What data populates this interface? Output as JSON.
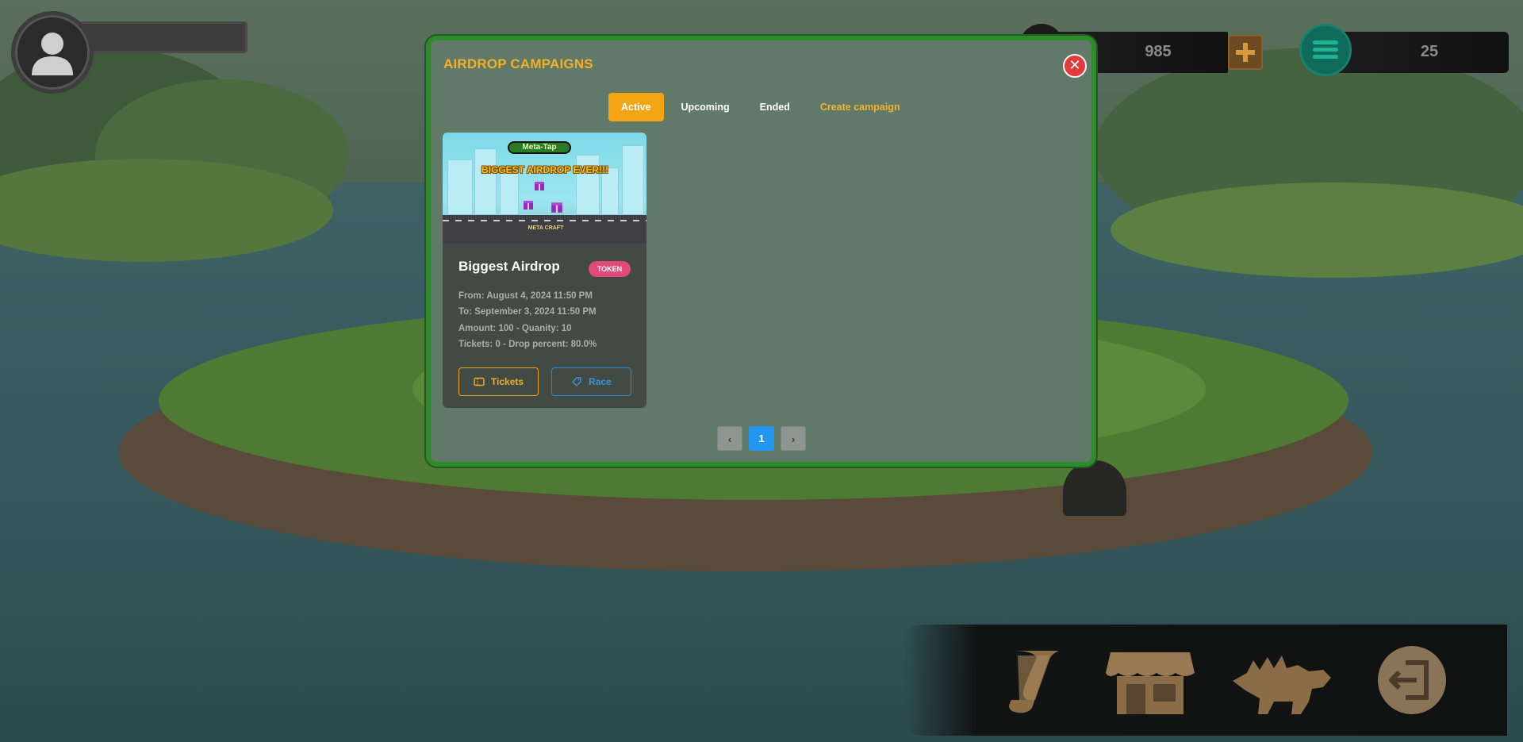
{
  "hud": {
    "currency_primary": "985",
    "currency_secondary": "25",
    "plus_icon": "plus-icon",
    "menu_icon": "stack-icon"
  },
  "modal": {
    "title": "AIRDROP CAMPAIGNS",
    "close_icon": "close-icon",
    "tabs": [
      {
        "label": "Active",
        "active": true
      },
      {
        "label": "Upcoming",
        "active": false
      },
      {
        "label": "Ended",
        "active": false
      },
      {
        "label": "Create campaign",
        "active": false
      }
    ],
    "campaigns": [
      {
        "banner": {
          "logo_text": "Meta-Tap",
          "headline": "BIGGEST AIRDROP EVER!!!",
          "footer_text": "META CRAFT"
        },
        "title": "Biggest Airdrop",
        "badge": "TOKEN",
        "from": "From: August 4, 2024 11:50 PM",
        "to": "To: September 3, 2024 11:50 PM",
        "amount": "Amount: 100 - Quanity: 10",
        "tickets": "Tickets: 0 - Drop percent: 80.0%",
        "tickets_button": "Tickets",
        "race_button": "Race"
      }
    ],
    "pagination": {
      "prev": "‹",
      "current": "1",
      "next": "›"
    }
  },
  "dock": {
    "icons": [
      "scroll-icon",
      "shop-icon",
      "dinosaur-icon",
      "exit-icon"
    ]
  },
  "colors": {
    "accent": "#f3a514",
    "modal_border": "#2f8a2e",
    "badge": "#e0497a",
    "primary_blue": "#2196f3",
    "close_red": "#e33b3b"
  }
}
